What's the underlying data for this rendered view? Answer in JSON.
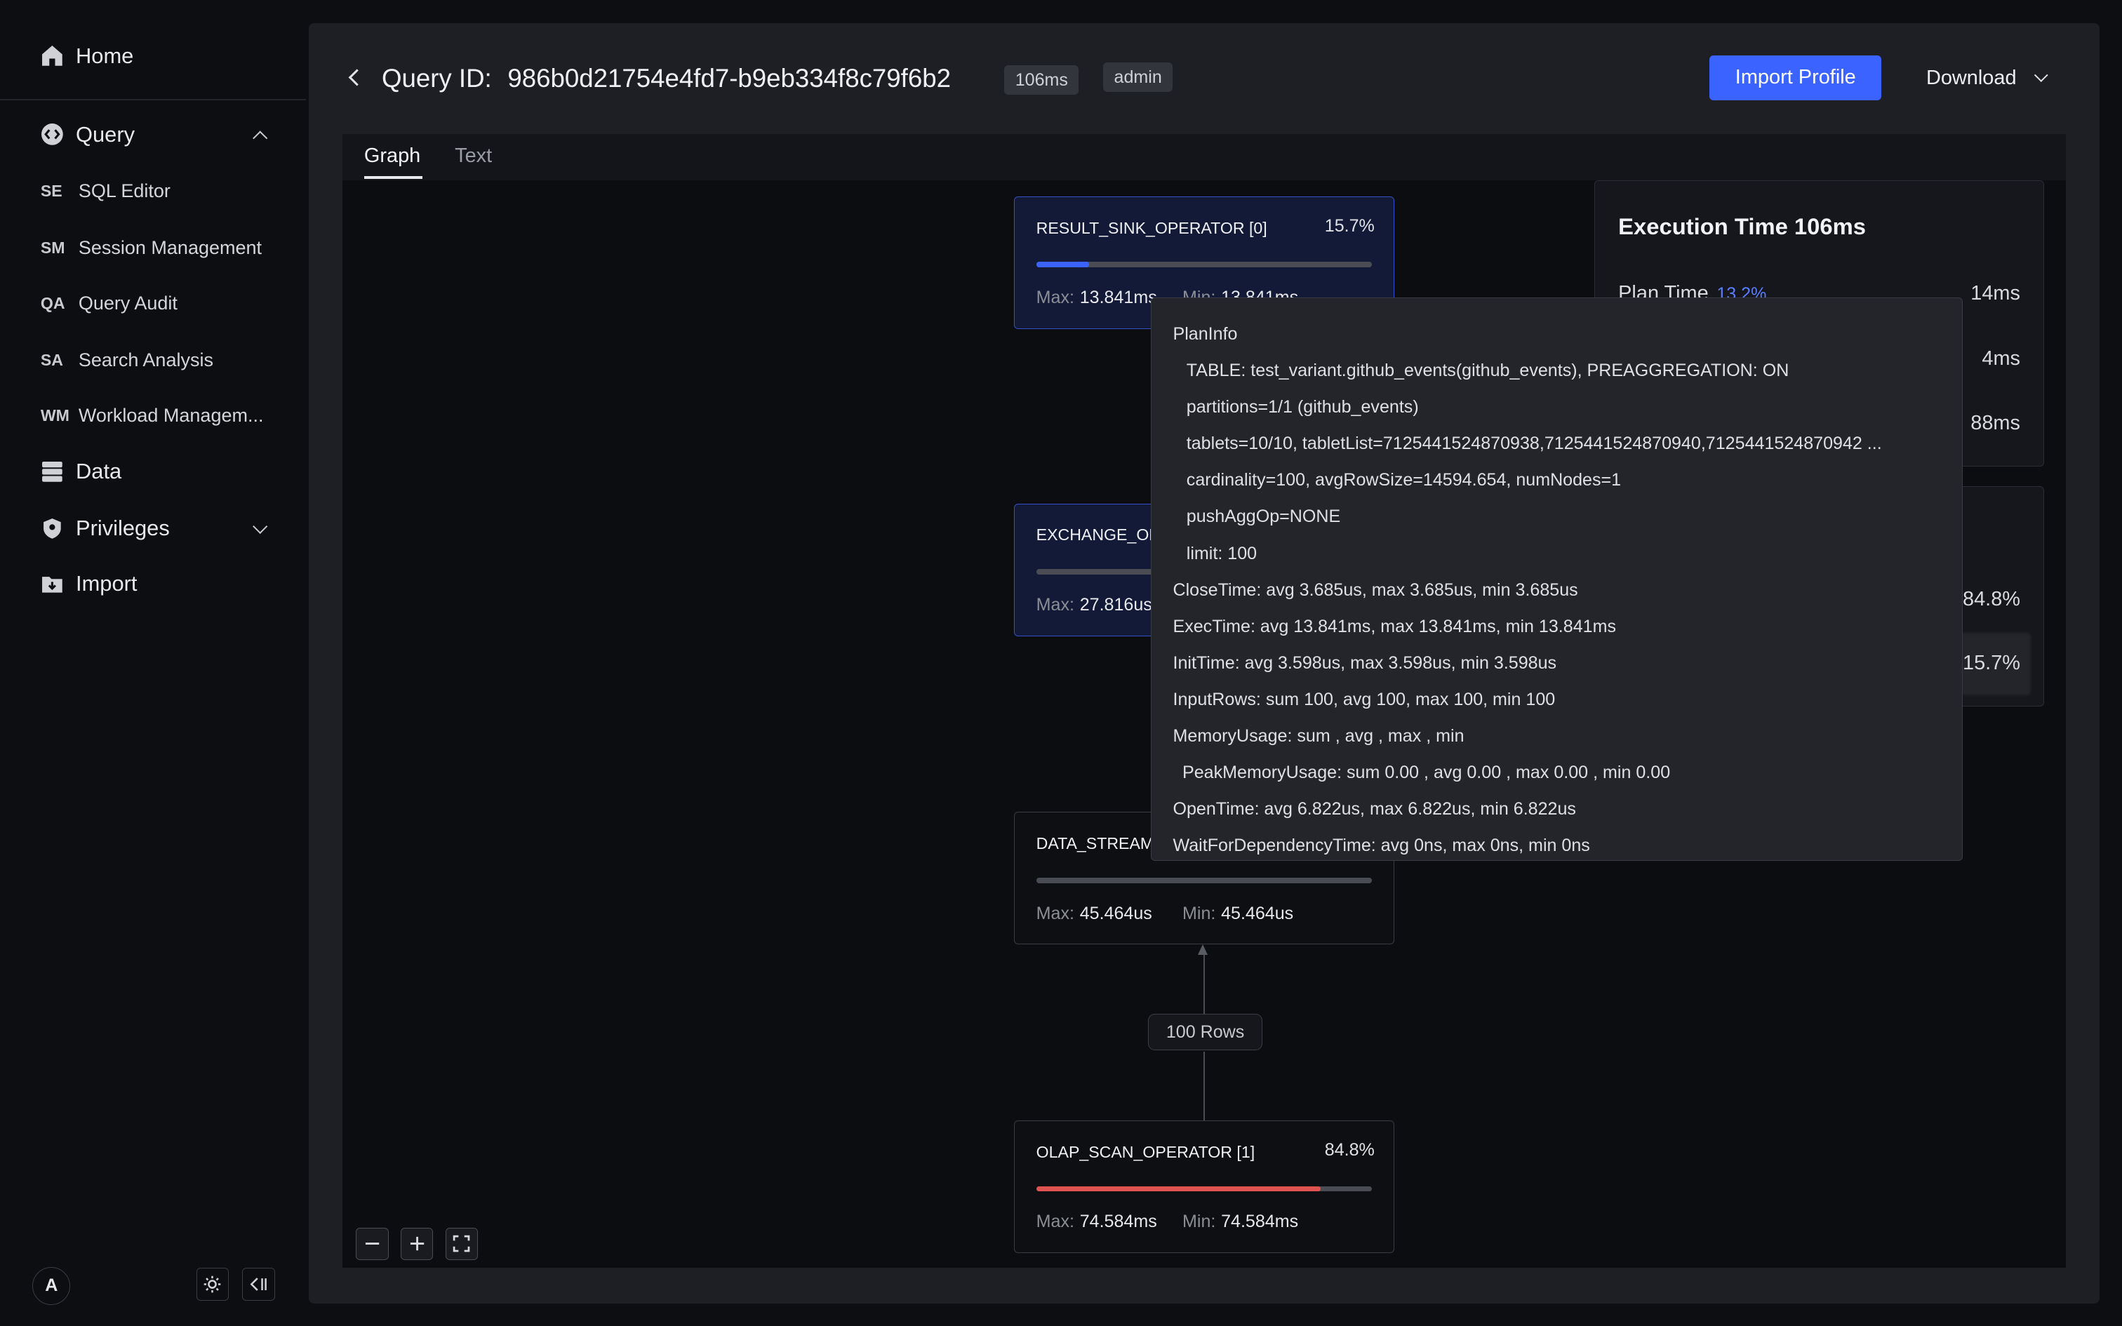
{
  "sidebar": {
    "home": "Home",
    "query": "Query",
    "sub_items": [
      {
        "abbr": "SE",
        "label": "SQL Editor"
      },
      {
        "abbr": "SM",
        "label": "Session Management"
      },
      {
        "abbr": "QA",
        "label": "Query Audit"
      },
      {
        "abbr": "SA",
        "label": "Search Analysis"
      },
      {
        "abbr": "WM",
        "label": "Workload Managem..."
      }
    ],
    "data": "Data",
    "privileges": "Privileges",
    "import": "Import",
    "avatar": "A"
  },
  "header": {
    "query_id_label": "Query ID:",
    "query_id": "986b0d21754e4fd7-b9eb334f8c79f6b2",
    "duration_badge": "106ms",
    "user_badge": "admin",
    "import_button": "Import Profile",
    "download_button": "Download"
  },
  "tabs": [
    "Graph",
    "Text"
  ],
  "nodes": [
    {
      "name": "RESULT_SINK_OPERATOR [0]",
      "pct": "15.7%",
      "fill": 0.157,
      "color": "#3b63ff",
      "max_label": "Max:",
      "max": "13.841ms",
      "min_label": "Min:",
      "min": "13.841ms"
    },
    {
      "name": "EXCHANGE_OP",
      "pct": "",
      "fill": 0,
      "color": "#3b63ff",
      "max_label": "Max:",
      "max": "27.816us",
      "min_label": "",
      "min": ""
    },
    {
      "name": "DATA_STREAM",
      "pct": "",
      "fill": 0,
      "color": "#3b63ff",
      "max_label": "Max:",
      "max": "45.464us",
      "min_label": "Min:",
      "min": "45.464us"
    },
    {
      "name": "OLAP_SCAN_OPERATOR [1]",
      "pct": "84.8%",
      "fill": 0.848,
      "color": "#e0524f",
      "max_label": "Max:",
      "max": "74.584ms",
      "min_label": "Min:",
      "min": "74.584ms"
    }
  ],
  "edge_label": "100 Rows",
  "execution": {
    "title": "Execution Time 106ms",
    "plan_time_label": "Plan Time",
    "plan_time_pct": "13.2%",
    "plan_time": "14ms",
    "row2_value": "4ms",
    "row3_value": "88ms",
    "panel2_values": [
      "84.8%",
      "15.7%"
    ]
  },
  "tooltip": [
    {
      "text": "PlanInfo",
      "indent": 0
    },
    {
      "text": "TABLE: test_variant.github_events(github_events), PREAGGREGATION: ON",
      "indent": 1
    },
    {
      "text": "partitions=1/1 (github_events)",
      "indent": 1
    },
    {
      "text": "tablets=10/10, tabletList=7125441524870938,7125441524870940,7125441524870942 ...",
      "indent": 1
    },
    {
      "text": "cardinality=100, avgRowSize=14594.654, numNodes=1",
      "indent": 1
    },
    {
      "text": "pushAggOp=NONE",
      "indent": 1
    },
    {
      "text": "limit: 100",
      "indent": 1
    },
    {
      "text": "CloseTime: avg 3.685us, max 3.685us, min 3.685us",
      "indent": 0
    },
    {
      "text": "ExecTime: avg 13.841ms, max 13.841ms, min 13.841ms",
      "indent": 0
    },
    {
      "text": "InitTime: avg 3.598us, max 3.598us, min 3.598us",
      "indent": 0
    },
    {
      "text": "InputRows: sum 100, avg 100, max 100, min 100",
      "indent": 0
    },
    {
      "text": "MemoryUsage: sum , avg , max , min",
      "indent": 0
    },
    {
      "text": "PeakMemoryUsage: sum 0.00 , avg 0.00 , max 0.00 , min 0.00",
      "indent": 2
    },
    {
      "text": "OpenTime: avg 6.822us, max 6.822us, min 6.822us",
      "indent": 0
    },
    {
      "text": "WaitForDependencyTime: avg 0ns, max 0ns, min 0ns",
      "indent": 0
    }
  ]
}
